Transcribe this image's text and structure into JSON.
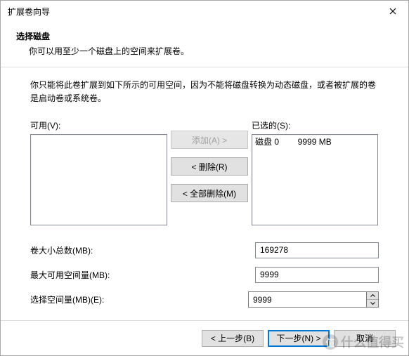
{
  "window": {
    "title": "扩展卷向导"
  },
  "header": {
    "title": "选择磁盘",
    "subtitle": "你可以用至少一个磁盘上的空间来扩展卷。"
  },
  "description": "你只能将此卷扩展到如下所示的可用空间，因为不能将磁盘转换为动态磁盘，或者被扩展的卷是启动卷或系统卷。",
  "lists": {
    "available_label": "可用(V):",
    "selected_label": "已选的(S):",
    "selected_items": [
      {
        "disk": "磁盘 0",
        "size": "9999 MB"
      }
    ]
  },
  "buttons": {
    "add": "添加(A) >",
    "remove": "< 删除(R)",
    "remove_all": "< 全部删除(M)",
    "back": "< 上一步(B)",
    "next": "下一步(N) >",
    "cancel": "取消"
  },
  "fields": {
    "total_label": "卷大小总数(MB):",
    "total_value": "169278",
    "max_label": "最大可用空间量(MB):",
    "max_value": "9999",
    "select_label": "选择空间量(MB)(E):",
    "select_value": "9999"
  },
  "watermark": {
    "text": "什么值得买",
    "icon": "值"
  }
}
